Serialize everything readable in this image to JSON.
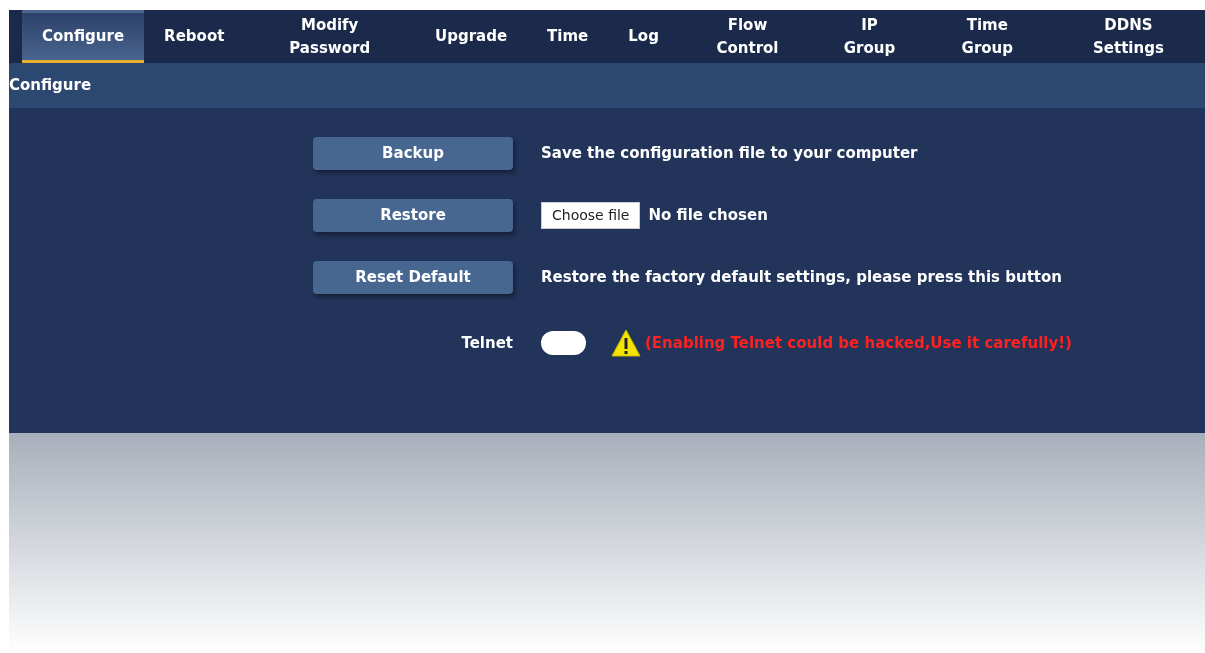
{
  "tabs": [
    {
      "label": "Configure",
      "selected": true
    },
    {
      "label": "Reboot",
      "selected": false
    },
    {
      "label": "Modify Password",
      "selected": false
    },
    {
      "label": "Upgrade",
      "selected": false
    },
    {
      "label": "Time",
      "selected": false
    },
    {
      "label": "Log",
      "selected": false
    },
    {
      "label": "Flow Control",
      "selected": false
    },
    {
      "label": "IP Group",
      "selected": false
    },
    {
      "label": "Time Group",
      "selected": false
    },
    {
      "label": "DDNS Settings",
      "selected": false
    }
  ],
  "section_title": "Configure",
  "rows": [
    {
      "kind": "button",
      "button": "Backup",
      "text": "Save the configuration file to your computer"
    },
    {
      "kind": "file",
      "button": "Restore",
      "file_button": "Choose file",
      "text": "No file chosen"
    },
    {
      "kind": "button",
      "button": "Reset Default",
      "text": "Restore the factory default settings, please press this button"
    },
    {
      "kind": "toggle",
      "label": "Telnet",
      "on": false,
      "warning": "(Enabling Telnet could be hacked,Use it carefully!)"
    }
  ]
}
